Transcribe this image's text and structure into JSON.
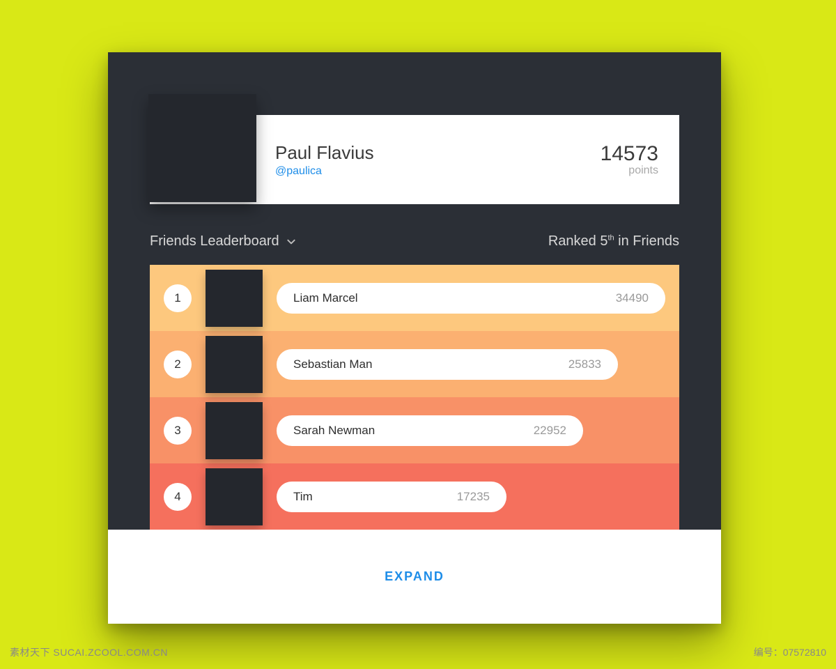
{
  "watermark": "素材天下 SUCAI.ZCOOL.COM.CN",
  "id_label": "编号：07572810",
  "profile": {
    "name": "Paul Flavius",
    "handle": "@paulica",
    "points": "14573",
    "points_label": "points"
  },
  "subheader": {
    "title": "Friends Leaderboard",
    "rank_prefix": "Ranked ",
    "rank_value": "5",
    "rank_ordinal": "th",
    "rank_suffix": " in Friends"
  },
  "rows": [
    {
      "rank": "1",
      "name": "Liam Marcel",
      "points": "34490"
    },
    {
      "rank": "2",
      "name": "Sebastian Man",
      "points": "25833"
    },
    {
      "rank": "3",
      "name": "Sarah Newman",
      "points": "22952"
    },
    {
      "rank": "4",
      "name": "Tim",
      "points": "17235"
    }
  ],
  "footer": {
    "expand": "EXPAND"
  }
}
